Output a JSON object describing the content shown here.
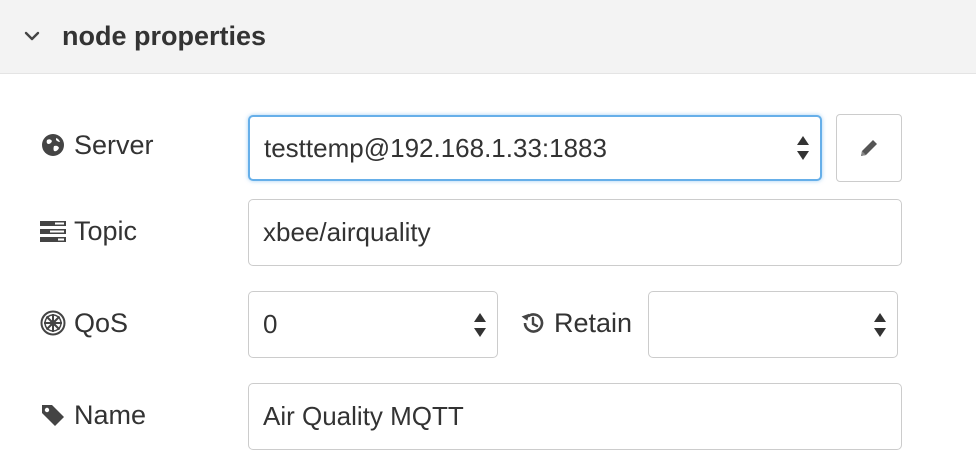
{
  "header": {
    "title": "node properties"
  },
  "server": {
    "label": "Server",
    "value": "testtemp@192.168.1.33:1883",
    "edit_icon": "pencil-icon"
  },
  "topic": {
    "label": "Topic",
    "value": "xbee/airquality"
  },
  "qos": {
    "label": "QoS",
    "value": "0"
  },
  "retain": {
    "label": "Retain",
    "value": ""
  },
  "name": {
    "label": "Name",
    "value": "Air Quality MQTT"
  },
  "colors": {
    "focus_border": "#66afe9",
    "header_bg": "#f3f3f3",
    "text": "#333333"
  }
}
